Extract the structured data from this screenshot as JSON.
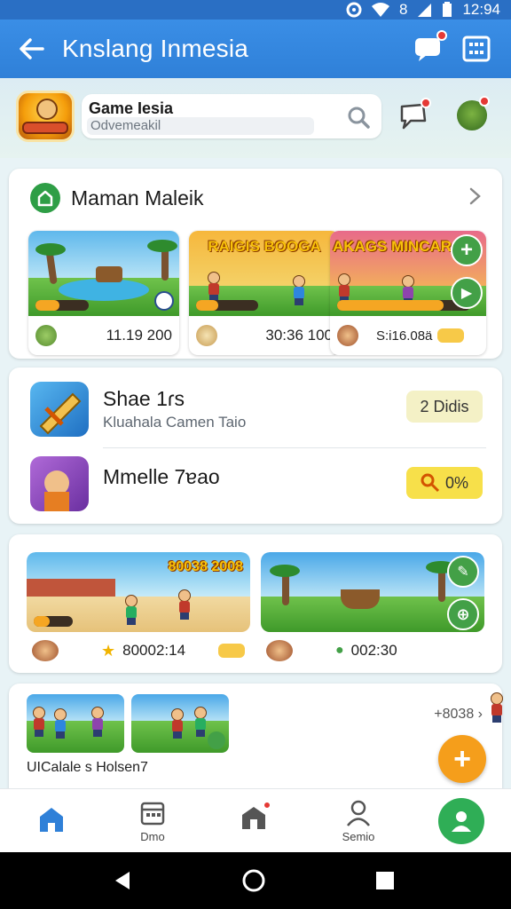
{
  "status_bar": {
    "time": "12:94",
    "signal_text": "8"
  },
  "app_bar": {
    "title": "Knslang Inmesia"
  },
  "search": {
    "title": "Game Ɩesia",
    "placeholder": "Odvemeakil"
  },
  "section_featured": {
    "title": "Maman Maleik",
    "games": [
      {
        "banner": "",
        "value": "11.19 200",
        "progress": 0.45
      },
      {
        "banner": "RAIGIS BOOGA",
        "value": "30:36 100",
        "progress": 0.35
      },
      {
        "banner": "AKAGS MINCAR",
        "value": "S:i16.08ä",
        "progress": 0.8
      }
    ]
  },
  "section_list": {
    "items": [
      {
        "name": "Shae 1ɾs",
        "sub": "Kluahala Camen Taio",
        "badge": "2 Didis"
      },
      {
        "name": "Mmelle 7ɐao",
        "sub": "",
        "badge": "0%"
      }
    ]
  },
  "section_events": {
    "cards": [
      {
        "banner": "80038 2008",
        "value": "80002:14"
      },
      {
        "banner": "",
        "value": "002:30"
      }
    ]
  },
  "section_more": {
    "caption": "UICalale s Holsen7",
    "count": "+8038"
  },
  "bottom_nav": {
    "items": [
      {
        "label": ""
      },
      {
        "label": "Dmo"
      },
      {
        "label": ""
      },
      {
        "label": "Semio"
      }
    ]
  },
  "colors": {
    "app_bar": "#2f80d8",
    "accent_green": "#2fae56",
    "accent_orange": "#f59e1b",
    "badge_yellow": "#f7e04a"
  }
}
